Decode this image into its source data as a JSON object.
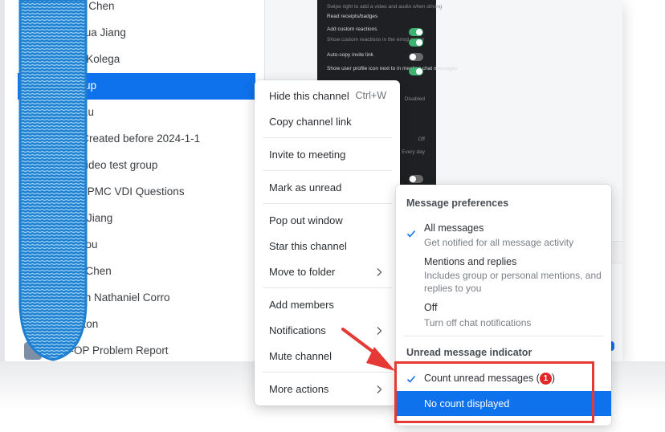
{
  "chat_list": {
    "items": [
      {
        "label": "Guanjin Chen",
        "selected": false
      },
      {
        "label": "Zhanghua Jiang",
        "selected": false
      },
      {
        "label": "William Kolega",
        "selected": false
      },
      {
        "label": "test group",
        "selected": true
      },
      {
        "label": "Yuling Xu",
        "selected": false
      },
      {
        "label": "Group Created before 2024-1-1",
        "selected": false
      },
      {
        "label": "Zoom Video test group",
        "selected": false
      },
      {
        "label": "Internal PMC VDI Questions",
        "selected": false
      },
      {
        "label": "Francis Jiang",
        "selected": false
      },
      {
        "label": "Claire You",
        "selected": false
      },
      {
        "label": "Delong Chen",
        "selected": false
      },
      {
        "label": "Christian Nathaniel Corro",
        "selected": false
      },
      {
        "label": "Ed Fenton",
        "selected": false
      },
      {
        "label": "Web-OP Problem Report",
        "selected": false
      }
    ]
  },
  "settings_preview": {
    "rows": [
      {
        "text": "Swipe right to add a video and audio when driving",
        "sub": true
      },
      {
        "text": "Read receipts/badges",
        "sub": false
      },
      {
        "text": "Add custom reactions",
        "sub": false
      },
      {
        "text": "Show custom reactions in the emoji picker",
        "sub": true
      },
      {
        "text": "Auto-copy invite link",
        "sub": false
      },
      {
        "text": "Show user profile icon next to in meeting chat messages",
        "sub": false
      },
      {
        "text": "Disabled",
        "sub": true
      },
      {
        "text": "Off",
        "sub": true
      },
      {
        "text": "Every day",
        "sub": true
      }
    ]
  },
  "context_menu": {
    "items": [
      {
        "label": "Hide this channel",
        "shortcut": "Ctrl+W",
        "submenu": false
      },
      {
        "label": "Copy channel link",
        "shortcut": "",
        "submenu": false
      },
      {
        "label": "Invite to meeting",
        "shortcut": "",
        "submenu": false
      },
      {
        "label": "Mark as unread",
        "shortcut": "",
        "submenu": false
      },
      {
        "label": "Pop out window",
        "shortcut": "",
        "submenu": false
      },
      {
        "label": "Star this channel",
        "shortcut": "",
        "submenu": false
      },
      {
        "label": "Move to folder",
        "shortcut": "",
        "submenu": true
      },
      {
        "label": "Add members",
        "shortcut": "",
        "submenu": false
      },
      {
        "label": "Notifications",
        "shortcut": "",
        "submenu": true
      },
      {
        "label": "Mute channel",
        "shortcut": "",
        "submenu": false
      },
      {
        "label": "More actions",
        "shortcut": "",
        "submenu": true
      }
    ]
  },
  "submenu": {
    "message_preferences_heading": "Message preferences",
    "options": [
      {
        "title": "All messages",
        "description": "Get notified for all message activity",
        "checked": true
      },
      {
        "title": "Mentions and replies",
        "description": "Includes group or personal mentions, and replies to you",
        "checked": false
      },
      {
        "title": "Off",
        "description": "Turn off chat notifications",
        "checked": false
      }
    ],
    "unread_heading": "Unread message indicator",
    "count_unread": {
      "prefix": "Count unread messages (",
      "badge": "1",
      "suffix": ")",
      "checked": true
    },
    "no_count": {
      "label": "No count displayed",
      "highlighted": true
    }
  },
  "colors": {
    "accent": "#0e72ed",
    "annotation": "#e53935",
    "badge": "#e02828",
    "redaction": "#1e8ad6"
  },
  "icons": {
    "check": "check-icon",
    "chevron": "chevron-right-icon",
    "annotation_arrow": "arrow-annotation-icon"
  }
}
